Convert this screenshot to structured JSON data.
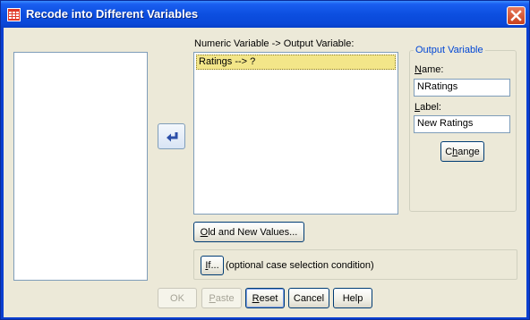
{
  "window": {
    "title": "Recode into Different Variables"
  },
  "variable_list": {
    "items": []
  },
  "mapping": {
    "label": "Numeric Variable -> Output Variable:",
    "items": [
      {
        "text": "Ratings --> ?",
        "selected": true
      }
    ]
  },
  "output_variable": {
    "legend": "Output Variable",
    "name_label": "Name:",
    "name_value": "NRatings",
    "label_label": "Label:",
    "label_value": "New Ratings",
    "change_button": "Change"
  },
  "old_new_values_button": "Old and New Values...",
  "if_button": "If...",
  "if_text": "(optional case selection condition)",
  "buttons": {
    "ok": "OK",
    "paste": "Paste",
    "reset": "Reset",
    "cancel": "Cancel",
    "help": "Help"
  },
  "colors": {
    "titlebar": "#0a48d8",
    "selection": "#f3e689",
    "dialog_bg": "#ece9d8",
    "accent_text": "#0046d5"
  }
}
